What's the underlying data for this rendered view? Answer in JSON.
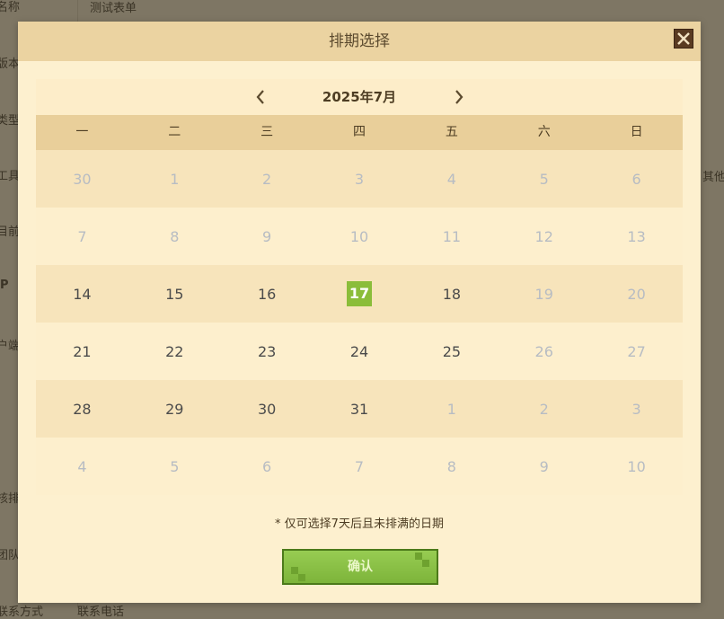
{
  "background": {
    "rows": [
      {
        "label": "名称",
        "value": "测试表单"
      },
      {
        "label": "版本",
        "value": ""
      },
      {
        "label": "类型",
        "value": ""
      },
      {
        "label": "工具",
        "value": "其他"
      },
      {
        "label": "目前",
        "value": ""
      },
      {
        "label": "P",
        "value": ""
      },
      {
        "label": "户端",
        "value": ""
      },
      {
        "label": "核排",
        "value": ""
      },
      {
        "label": "团队",
        "value": ""
      },
      {
        "label": "联系方式",
        "value": "联系电话"
      }
    ]
  },
  "modal": {
    "title": "排期选择",
    "close_icon": "close-icon",
    "calendar": {
      "month_label": "2025年7月",
      "prev_icon": "chevron-left-icon",
      "next_icon": "chevron-right-icon",
      "weekdays": [
        "一",
        "二",
        "三",
        "四",
        "五",
        "六",
        "日"
      ],
      "selected_day": "17",
      "weeks": [
        [
          {
            "d": "30",
            "muted": true
          },
          {
            "d": "1",
            "muted": true
          },
          {
            "d": "2",
            "muted": true
          },
          {
            "d": "3",
            "muted": true
          },
          {
            "d": "4",
            "muted": true
          },
          {
            "d": "5",
            "muted": true
          },
          {
            "d": "6",
            "muted": true
          }
        ],
        [
          {
            "d": "7",
            "muted": true
          },
          {
            "d": "8",
            "muted": true
          },
          {
            "d": "9",
            "muted": true
          },
          {
            "d": "10",
            "muted": true
          },
          {
            "d": "11",
            "muted": true
          },
          {
            "d": "12",
            "muted": true
          },
          {
            "d": "13",
            "muted": true
          }
        ],
        [
          {
            "d": "14",
            "muted": false
          },
          {
            "d": "15",
            "muted": false
          },
          {
            "d": "16",
            "muted": false
          },
          {
            "d": "17",
            "muted": false,
            "selected": true
          },
          {
            "d": "18",
            "muted": false
          },
          {
            "d": "19",
            "muted": true
          },
          {
            "d": "20",
            "muted": true
          }
        ],
        [
          {
            "d": "21",
            "muted": false
          },
          {
            "d": "22",
            "muted": false
          },
          {
            "d": "23",
            "muted": false
          },
          {
            "d": "24",
            "muted": false
          },
          {
            "d": "25",
            "muted": false
          },
          {
            "d": "26",
            "muted": true
          },
          {
            "d": "27",
            "muted": true
          }
        ],
        [
          {
            "d": "28",
            "muted": false
          },
          {
            "d": "29",
            "muted": false
          },
          {
            "d": "30",
            "muted": false
          },
          {
            "d": "31",
            "muted": false
          },
          {
            "d": "1",
            "muted": true
          },
          {
            "d": "2",
            "muted": true
          },
          {
            "d": "3",
            "muted": true
          }
        ],
        [
          {
            "d": "4",
            "muted": true
          },
          {
            "d": "5",
            "muted": true
          },
          {
            "d": "6",
            "muted": true
          },
          {
            "d": "7",
            "muted": true
          },
          {
            "d": "8",
            "muted": true
          },
          {
            "d": "9",
            "muted": true
          },
          {
            "d": "10",
            "muted": true
          }
        ]
      ]
    },
    "note": "* 仅可选择7天后且未排满的日期",
    "confirm_label": "确认"
  },
  "colors": {
    "selected": "#8bbd3a",
    "confirm": "#8bc34a",
    "header": "#ebd3a1",
    "muted_text": "#b7bcc3"
  }
}
